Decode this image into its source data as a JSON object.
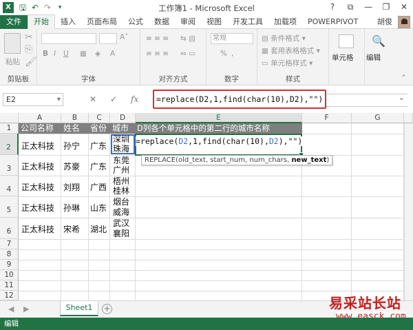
{
  "window": {
    "title": "工作簿1 - Microsoft Excel"
  },
  "ribbon_tabs": {
    "file": "文件",
    "tabs": [
      "开始",
      "插入",
      "页面布局",
      "公式",
      "数据",
      "审阅",
      "视图",
      "开发工具",
      "加载项",
      "POWERPIVOT"
    ],
    "user": "胡俊"
  },
  "ribbon_groups": {
    "clipboard": {
      "label": "剪贴板",
      "paste": "粘贴"
    },
    "font": {
      "label": "字体"
    },
    "alignment": {
      "label": "对齐方式"
    },
    "number": {
      "label": "数字",
      "format": "常规",
      "percent": "%"
    },
    "styles": {
      "label": "样式",
      "items": [
        "条件格式",
        "套用表格格式",
        "单元格样式"
      ]
    },
    "cells": {
      "label": "单元格"
    },
    "editing": {
      "label": "编辑"
    }
  },
  "formula_bar": {
    "name_box": "E2",
    "cancel": "✕",
    "confirm": "✓",
    "fx": "fx",
    "formula": "=replace(D2,1,find(char(10),D2),\"\")"
  },
  "columns": [
    "A",
    "B",
    "C",
    "D",
    "E",
    "F",
    "G"
  ],
  "rows": [
    "1",
    "2",
    "3",
    "4",
    "5",
    "6",
    "7",
    "8",
    "9",
    "10",
    "11",
    "12"
  ],
  "table": {
    "headers": [
      "公司名称",
      "姓名",
      "省份",
      "城市",
      "D列各个单元格中的第二行的城市名称"
    ],
    "records": [
      {
        "company": "正太科技",
        "name": "孙宁",
        "province": "广东",
        "city_line1": "深圳",
        "city_line2": "珠海"
      },
      {
        "company": "正太科技",
        "name": "苏豪",
        "province": "广东",
        "city_line1": "东莞",
        "city_line2": "广州"
      },
      {
        "company": "正太科技",
        "name": "刘翔",
        "province": "广西",
        "city_line1": "梧州",
        "city_line2": "桂林"
      },
      {
        "company": "正太科技",
        "name": "孙琳",
        "province": "山东",
        "city_line1": "烟台",
        "city_line2": "威海"
      },
      {
        "company": "正太科技",
        "name": "宋希",
        "province": "湖北",
        "city_line1": "武汉",
        "city_line2": "襄阳"
      }
    ]
  },
  "editing_cell": {
    "prefix": "=replace(",
    "ref1": "D2",
    "middle": ",1,find(char(10),",
    "ref2": "D2",
    "suffix": "),\"\")"
  },
  "tooltip": {
    "args": "REPLACE(old_text, start_num, num_chars, ",
    "bold_arg": "new_text",
    "close": ")"
  },
  "sheets": {
    "tabs": [
      "Sheet1"
    ],
    "add": "+"
  },
  "status_bar": {
    "mode": "编辑"
  },
  "watermark": {
    "line1": "易采站长站",
    "line2": "www.easck.com"
  },
  "colors": {
    "accent": "#217346",
    "highlight": "#d32f2f",
    "header_fill": "#7f7f7f"
  }
}
